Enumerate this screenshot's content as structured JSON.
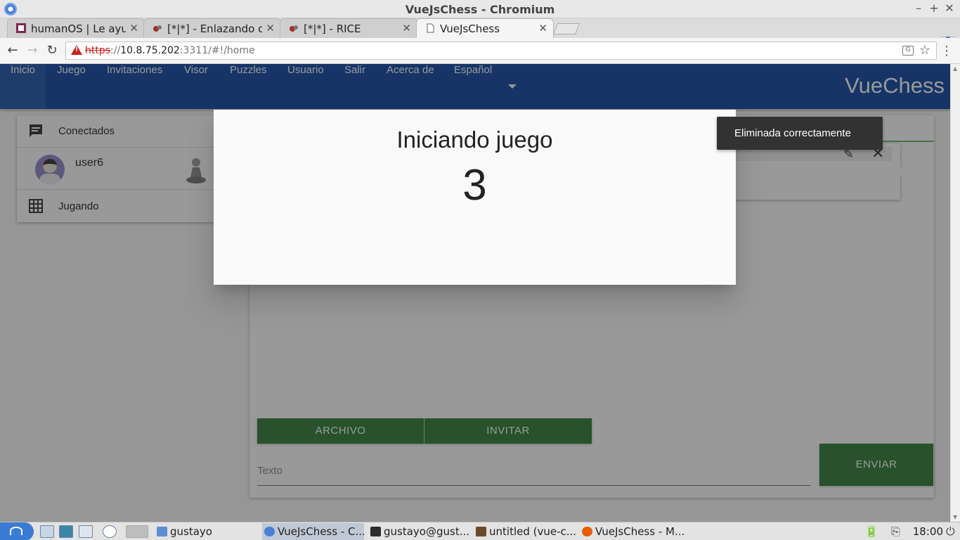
{
  "window": {
    "title": "VueJsChess - Chromium"
  },
  "tabs": [
    {
      "label": "humanOS | Le ayud",
      "icon": "humanos-favicon"
    },
    {
      "label": "[*|*] - Enlazando co",
      "icon": "rice-favicon"
    },
    {
      "label": "[*|*] - RICE",
      "icon": "rice-favicon"
    },
    {
      "label": "VueJsChess",
      "icon": "page-icon",
      "active": true
    }
  ],
  "address": {
    "scheme": "https",
    "host": "10.8.75.202",
    "rest": ":3311/#!/home"
  },
  "nav": {
    "items": [
      "Inicio",
      "Juego",
      "Invitaciones",
      "Visor",
      "Puzzles",
      "Usuario",
      "Salir",
      "Acerca de",
      "Español"
    ],
    "brand": "VueChess"
  },
  "sidebar": {
    "connected_label": "Conectados",
    "user_name": "user6",
    "playing_label": "Jugando"
  },
  "chat": {
    "file_button": "ARCHIVO",
    "invite_button": "INVITAR",
    "send_button": "ENVIAR",
    "text_placeholder": "Texto"
  },
  "dialog": {
    "title": "Iniciando juego",
    "countdown": "3"
  },
  "snackbar": {
    "message": "Eliminada correctamente"
  },
  "taskbar": {
    "items": [
      "gustayo",
      "VueJsChess - C...",
      "gustayo@gust...",
      "untitled (vue-c...",
      "VueJsChess - M..."
    ],
    "clock": "18:00"
  },
  "colors": {
    "appbar": "#0d47a1",
    "button_green": "#2e7d32",
    "snackbar": "#323232"
  }
}
